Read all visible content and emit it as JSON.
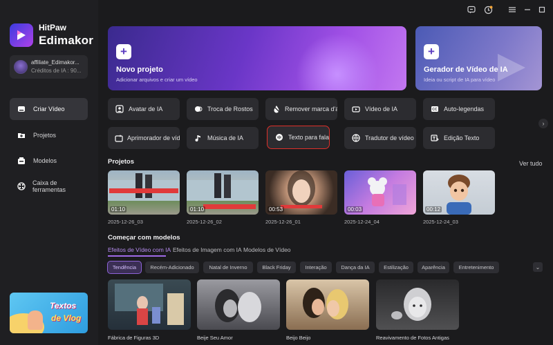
{
  "brand": {
    "line1": "HitPaw",
    "line2": "Edimakor"
  },
  "account": {
    "name": "affiliate_Edimakor...",
    "credits": "Créditos de IA : 90..."
  },
  "nav": [
    {
      "label": "Criar Vídeo",
      "icon": "create-video-icon",
      "active": true
    },
    {
      "label": "Projetos",
      "icon": "folder-icon"
    },
    {
      "label": "Modelos",
      "icon": "templates-icon"
    },
    {
      "label": "Caixa de ferramentas",
      "icon": "toolbox-icon"
    }
  ],
  "promo": {
    "line1": "Textos",
    "line2": "de Vlog"
  },
  "hero": {
    "new_project": {
      "title": "Novo projeto",
      "subtitle": "Adicionar arquivos e criar um vídeo"
    },
    "generator": {
      "title": "Gerador de Vídeo de IA",
      "subtitle": "Ideia ou script de IA para vídeo"
    }
  },
  "tools": [
    {
      "label": "Avatar de IA",
      "icon": "avatar-icon"
    },
    {
      "label": "Troca de Rostos",
      "icon": "face-swap-icon"
    },
    {
      "label": "Remover marca d'água",
      "icon": "watermark-remove-icon"
    },
    {
      "label": "Vídeo de IA",
      "icon": "ai-video-icon"
    },
    {
      "label": "Auto-legendas",
      "icon": "captions-icon"
    },
    {
      "label": "Aprimorador de vídeo",
      "icon": "enhancer-icon"
    },
    {
      "label": "Música de IA",
      "icon": "music-icon"
    },
    {
      "label": "Texto para fala",
      "icon": "tts-icon",
      "highlighted": true
    },
    {
      "label": "Tradutor de vídeo",
      "icon": "translate-icon"
    },
    {
      "label": "Edição Texto",
      "icon": "text-edit-icon"
    }
  ],
  "projects": {
    "title": "Projetos",
    "see_all": "Ver tudo",
    "items": [
      {
        "duration": "01:10",
        "date": "2025-12-26_03"
      },
      {
        "duration": "01:10",
        "date": "2025-12-26_02"
      },
      {
        "duration": "00:53",
        "date": "2025-12-26_01"
      },
      {
        "duration": "00:03",
        "date": "2025-12-24_04"
      },
      {
        "duration": "00:12",
        "date": "2025-12-24_03"
      }
    ]
  },
  "templates": {
    "title": "Começar com modelos",
    "tabs": [
      "Efeitos de Vídeo com IA",
      "Efeitos de Imagem com IA",
      "Modelos de Vídeo"
    ],
    "chips": [
      "Tendência",
      "Recém-Adicionado",
      "Natal de Inverno",
      "Black Friday",
      "Interação",
      "Dança da IA",
      "Estilização",
      "Aparência",
      "Entretenimento"
    ],
    "items": [
      "Fábrica de Figuras 3D",
      "Beije Seu Amor",
      "Beijo Beijo",
      "Reavivamento de Fotos Antigas"
    ]
  },
  "colors": {
    "accent": "#a06ae8",
    "highlight": "#e0302a",
    "background": "#1b1b1d"
  }
}
